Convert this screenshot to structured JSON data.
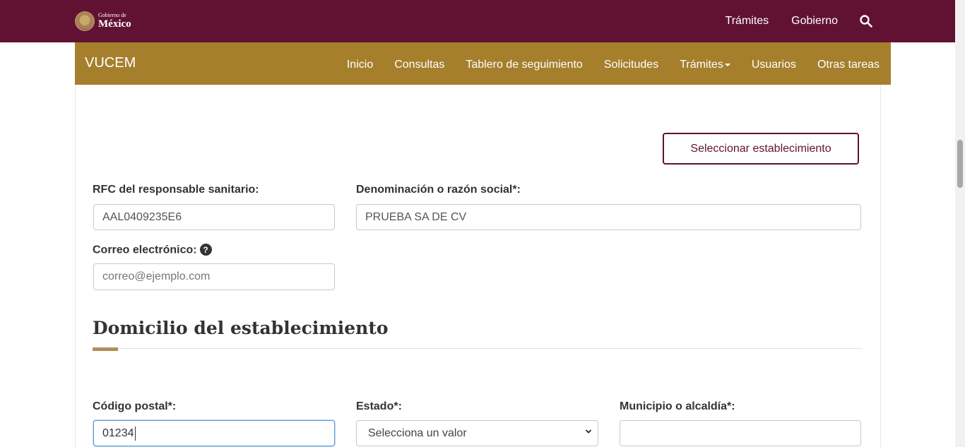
{
  "gov": {
    "logo_small": "Gobierno de",
    "logo_big": "México",
    "nav": [
      "Trámites",
      "Gobierno"
    ]
  },
  "vucem": {
    "brand": "VUCEM",
    "nav": [
      "Inicio",
      "Consultas",
      "Tablero de seguimiento",
      "Solicitudes",
      "Trámites",
      "Usuarios",
      "Otras tareas"
    ]
  },
  "form": {
    "select_button": "Seleccionar establecimiento",
    "rfc_label": "RFC del responsable sanitario:",
    "rfc_value": "AAL0409235E6",
    "razon_label": "Denominación o razón social*:",
    "razon_value": "PRUEBA SA DE CV",
    "correo_label": "Correo electrónico:",
    "correo_placeholder": "correo@ejemplo.com",
    "help_glyph": "?"
  },
  "domicilio": {
    "title": "Domicilio del establecimiento",
    "cp_label": "Código postal*:",
    "cp_value": "01234",
    "estado_label": "Estado*:",
    "estado_value": "Selecciona un valor",
    "municipio_label": "Municipio o alcaldía*:",
    "municipio_value": ""
  },
  "colors": {
    "gov_bar": "#611232",
    "vucem_bar": "#a57f2c",
    "accent": "#b38e5d"
  }
}
